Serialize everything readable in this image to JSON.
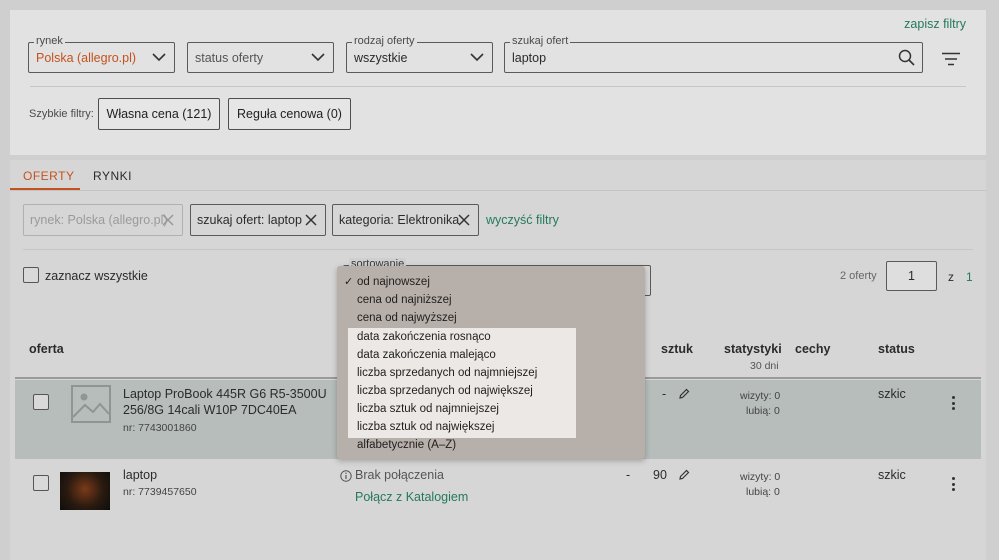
{
  "filters": {
    "save_link": "zapisz filtry",
    "market": {
      "legend": "rynek",
      "value": "Polska (allegro.pl)"
    },
    "status": {
      "value": "status oferty"
    },
    "offer_type": {
      "legend": "rodzaj oferty",
      "value": "wszystkie"
    },
    "search": {
      "legend": "szukaj ofert",
      "value": "laptop"
    },
    "quick_label": "Szybkie filtry:",
    "quick_buttons": [
      "Własna cena (121)",
      "Reguła cenowa (0)"
    ]
  },
  "tabs": [
    "OFERTY",
    "RYNKI"
  ],
  "active_chips": {
    "chip1": {
      "label": "rynek:",
      "value": "Polska (allegro.pl)"
    },
    "chip2": {
      "label": "szukaj ofert:",
      "value": "laptop"
    },
    "chip3": {
      "label": "kategoria:",
      "value": "Elektronika"
    },
    "clear": "wyczyść filtry"
  },
  "list": {
    "select_all": "zaznacz wszystkie",
    "sort_legend": "sortowanie",
    "count": "2 oferty",
    "page": "1",
    "page_of": "z",
    "page_total": "1"
  },
  "columns": {
    "offer": "oferta",
    "pieces": "sztuk",
    "stats": "statystyki",
    "stats_sub": "30 dni",
    "features": "cechy",
    "status": "status"
  },
  "rows": [
    {
      "title_line1": "Laptop ProBook 445R G6 R5-3500U",
      "title_line2": "256/8G 14cali W10P 7DC40EA",
      "number": "nr: 7743001860",
      "pieces": "-",
      "visits": "wizyty: 0",
      "likes": "lubią: 0",
      "status": "szkic"
    },
    {
      "title_line1": "laptop",
      "number": "nr: 7739457650",
      "connection": "Brak połączenia",
      "connect_link": "Połącz z Katalogiem",
      "price": "-",
      "pieces": "90",
      "visits": "wizyty: 0",
      "likes": "lubią: 0",
      "status": "szkic"
    }
  ],
  "sort_options": [
    "od najnowszej",
    "cena od najniższej",
    "cena od najwyższej",
    "data zakończenia rosnąco",
    "data zakończenia malejąco",
    "liczba sprzedanych od najmniejszej",
    "liczba sprzedanych od największej",
    "liczba sztuk od najmniejszej",
    "liczba sztuk od największej",
    "alfabetycznie (A–Z)"
  ],
  "sort_selected": "✓",
  "colors": {
    "accent": "#c4521f",
    "link": "#237a5a"
  }
}
